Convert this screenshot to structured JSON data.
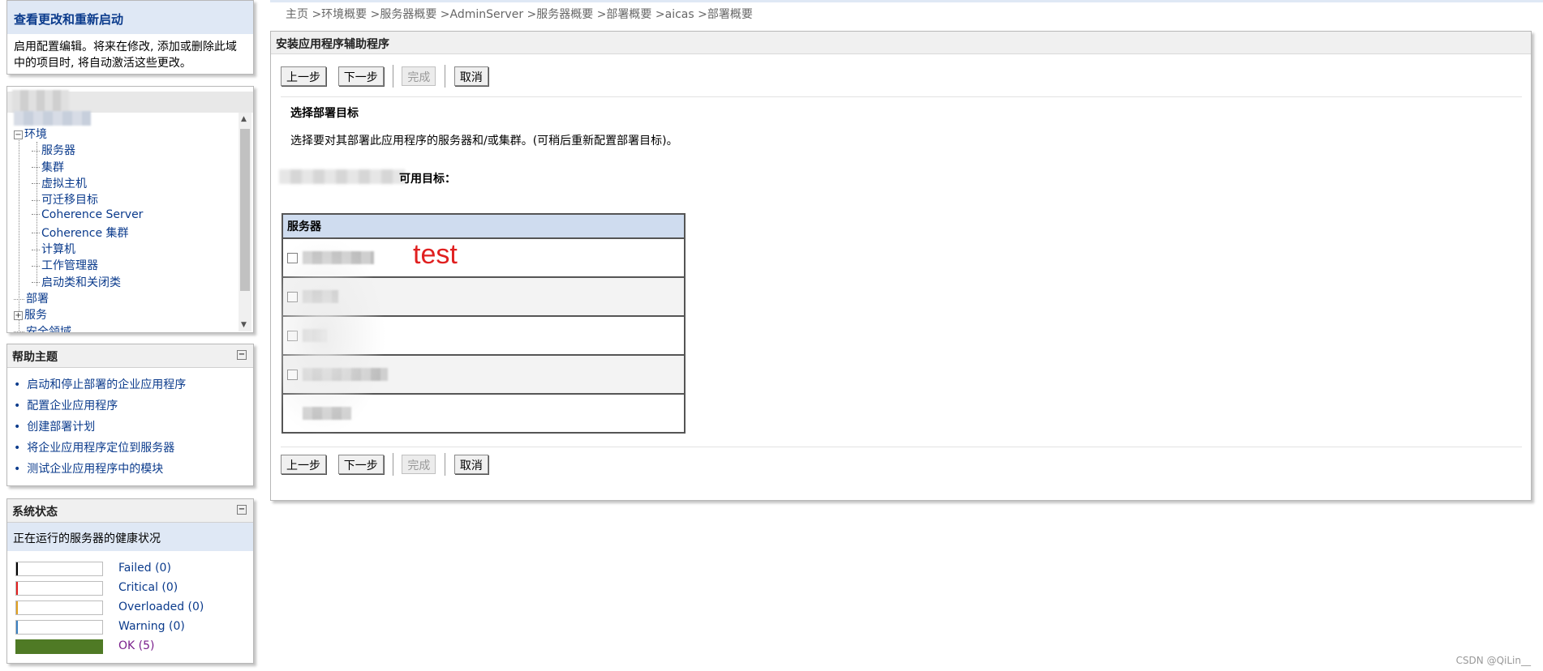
{
  "change_center": {
    "title": "查看更改和重新启动",
    "description": "启用配置编辑。将来在修改, 添加或删除此域中的项目时, 将自动激活这些更改。"
  },
  "domain_tree": {
    "items": [
      {
        "label": "环境",
        "level": 0,
        "expander": "−"
      },
      {
        "label": "服务器",
        "level": 1
      },
      {
        "label": "集群",
        "level": 1
      },
      {
        "label": "虚拟主机",
        "level": 1
      },
      {
        "label": "可迁移目标",
        "level": 1
      },
      {
        "label": "Coherence Server",
        "level": 1
      },
      {
        "label": "Coherence 集群",
        "level": 1
      },
      {
        "label": "计算机",
        "level": 1
      },
      {
        "label": "工作管理器",
        "level": 1
      },
      {
        "label": "启动类和关闭类",
        "level": 1
      },
      {
        "label": "部署",
        "level": 0
      },
      {
        "label": "服务",
        "level": 0,
        "expander": "+"
      },
      {
        "label": "安全领域",
        "level": 0
      }
    ]
  },
  "help": {
    "title": "帮助主题",
    "items": [
      "启动和停止部署的企业应用程序",
      "配置企业应用程序",
      "创建部署计划",
      "将企业应用程序定位到服务器",
      "测试企业应用程序中的模块"
    ]
  },
  "system_status": {
    "title": "系统状态",
    "subtitle": "正在运行的服务器的健康状况",
    "rows": [
      {
        "label": "Failed (0)",
        "color": "#000000",
        "link": "#0b3b8c"
      },
      {
        "label": "Critical (0)",
        "color": "#e02020",
        "link": "#0b3b8c"
      },
      {
        "label": "Overloaded (0)",
        "color": "#e0a020",
        "link": "#0b3b8c"
      },
      {
        "label": "Warning (0)",
        "color": "#3a80c0",
        "link": "#0b3b8c"
      },
      {
        "label": "OK (5)",
        "color": "#4f7a25",
        "link": "#7a1f8c"
      }
    ]
  },
  "breadcrumb": {
    "text": "主页 >环境概要 >服务器概要 >AdminServer >服务器概要 >部署概要 >aicas >部署概要"
  },
  "wizard": {
    "title": "安装应用程序辅助程序",
    "buttons": {
      "back": "上一步",
      "next": "下一步",
      "finish": "完成",
      "cancel": "取消"
    },
    "section_title": "选择部署目标",
    "section_desc": "选择要对其部署此应用程序的服务器和/或集群。(可稍后重新配置部署目标)。",
    "available_label": "可用目标：",
    "table_header": "服务器",
    "annotation": "test"
  },
  "watermark": "CSDN @QiLin__"
}
